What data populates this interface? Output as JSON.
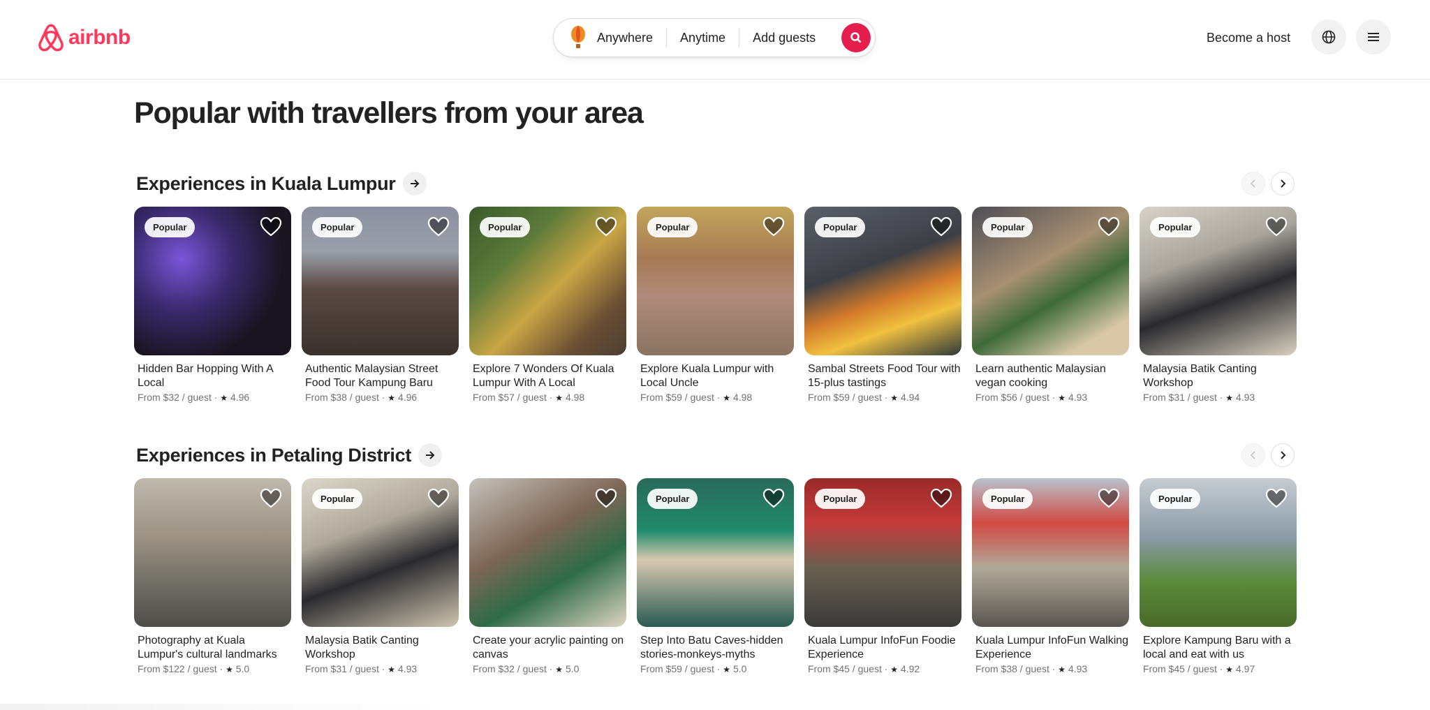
{
  "header": {
    "logo_text": "airbnb",
    "search": {
      "anywhere": "Anywhere",
      "anytime": "Anytime",
      "guests": "Add guests"
    },
    "become_host": "Become a host"
  },
  "page_title": "Popular with travellers from your area",
  "sections": [
    {
      "title": "Experiences in Kuala Lumpur",
      "cards": [
        {
          "badge": "Popular",
          "title": "Hidden Bar Hopping With A Local",
          "price": "From $32 / guest",
          "rating": "4.96"
        },
        {
          "badge": "Popular",
          "title": "Authentic Malaysian Street Food Tour Kampung Baru",
          "price": "From $38 / guest",
          "rating": "4.96"
        },
        {
          "badge": "Popular",
          "title": "Explore 7 Wonders Of Kuala Lumpur With A Local",
          "price": "From $57 / guest",
          "rating": "4.98"
        },
        {
          "badge": "Popular",
          "title": "Explore Kuala Lumpur with Local Uncle",
          "price": "From $59 / guest",
          "rating": "4.98"
        },
        {
          "badge": "Popular",
          "title": "Sambal Streets Food Tour with 15-plus tastings",
          "price": "From $59 / guest",
          "rating": "4.94"
        },
        {
          "badge": "Popular",
          "title": "Learn authentic Malaysian vegan cooking",
          "price": "From $56 / guest",
          "rating": "4.93"
        },
        {
          "badge": "Popular",
          "title": "Malaysia Batik Canting Workshop",
          "price": "From $31 / guest",
          "rating": "4.93"
        }
      ]
    },
    {
      "title": "Experiences in Petaling District",
      "cards": [
        {
          "badge": "",
          "title": "Photography at Kuala Lumpur's cultural landmarks",
          "price": "From $122 / guest",
          "rating": "5.0"
        },
        {
          "badge": "Popular",
          "title": "Malaysia Batik Canting Workshop",
          "price": "From $31 / guest",
          "rating": "4.93"
        },
        {
          "badge": "",
          "title": "Create your acrylic painting on canvas",
          "price": "From $32 / guest",
          "rating": "5.0"
        },
        {
          "badge": "Popular",
          "title": "Step Into Batu Caves-hidden stories-monkeys-myths",
          "price": "From $59 / guest",
          "rating": "5.0"
        },
        {
          "badge": "Popular",
          "title": "Kuala Lumpur InfoFun Foodie Experience",
          "price": "From $45 / guest",
          "rating": "4.92"
        },
        {
          "badge": "Popular",
          "title": "Kuala Lumpur InfoFun Walking Experience",
          "price": "From $38 / guest",
          "rating": "4.93"
        },
        {
          "badge": "Popular",
          "title": "Explore Kampung Baru with a local and eat with us",
          "price": "From $45 / guest",
          "rating": "4.97"
        }
      ]
    }
  ],
  "colors": {
    "brand": "#ff385c",
    "search_button": "#e61e4d"
  },
  "icons": [
    "airbnb-logo-icon",
    "balloon-icon",
    "search-icon",
    "globe-icon",
    "menu-icon",
    "arrow-right-icon",
    "chevron-left-icon",
    "chevron-right-icon",
    "heart-icon",
    "star-icon"
  ]
}
